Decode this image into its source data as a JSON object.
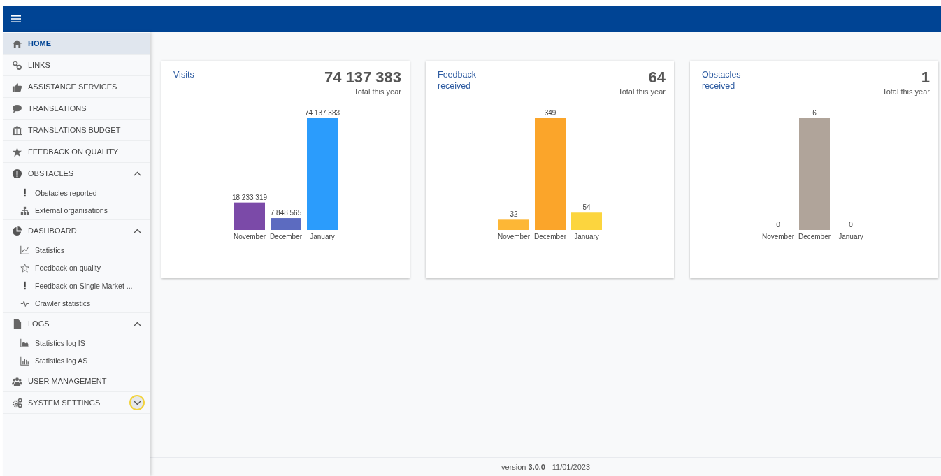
{
  "sidebar": {
    "items": [
      {
        "label": "HOME",
        "selected": true
      },
      {
        "label": "LINKS",
        "selected": false
      },
      {
        "label": "ASSISTANCE SERVICES",
        "selected": false
      },
      {
        "label": "TRANSLATIONS",
        "selected": false
      },
      {
        "label": "TRANSLATIONS BUDGET",
        "selected": false
      },
      {
        "label": "FEEDBACK ON QUALITY",
        "selected": false
      },
      {
        "label": "OBSTACLES",
        "selected": false,
        "focused": false,
        "expanded": true,
        "children": [
          {
            "label": "Obstacles reported",
            "selected": false
          },
          {
            "label": "External organisations",
            "selected": false
          }
        ]
      },
      {
        "label": "DASHBOARD",
        "selected": false,
        "focused": false,
        "expanded": true,
        "children": [
          {
            "label": "Statistics",
            "selected": false
          },
          {
            "label": "Feedback on quality",
            "selected": false
          },
          {
            "label": "Feedback on Single Market ...",
            "selected": false
          },
          {
            "label": "Crawler statistics",
            "selected": false
          }
        ]
      },
      {
        "label": "LOGS",
        "selected": false,
        "focused": false,
        "expanded": true,
        "children": [
          {
            "label": "Statistics log IS",
            "selected": false
          },
          {
            "label": "Statistics log AS",
            "selected": false
          }
        ]
      },
      {
        "label": "USER MANAGEMENT",
        "selected": false
      },
      {
        "label": "SYSTEM SETTINGS",
        "selected": false,
        "focused": true,
        "expanded": false
      }
    ]
  },
  "cards": [
    {
      "title": "Visits",
      "total": "74 137 383",
      "total_label": "Total this year",
      "chart_data": {
        "type": "bar",
        "categories": [
          "November",
          "December",
          "January"
        ],
        "series": [
          {
            "values": [
              18233319,
              7848565,
              74137383
            ]
          }
        ],
        "colors": [
          "#7b4aa8",
          "#5c6bc0",
          "#2b9cfc"
        ],
        "data_labels": true
      }
    },
    {
      "title": "Feedback received",
      "total": "64",
      "total_label": "Total this year",
      "chart_data": {
        "type": "bar",
        "categories": [
          "November",
          "December",
          "January"
        ],
        "series": [
          {
            "values": [
              32,
              349,
              54
            ]
          }
        ],
        "colors": [
          "#fdb736",
          "#fba52a",
          "#fcd53e"
        ],
        "data_labels": true
      }
    },
    {
      "title": "Obstacles received",
      "total": "1",
      "total_label": "Total this year",
      "chart_data": {
        "type": "bar",
        "categories": [
          "November",
          "December",
          "January"
        ],
        "series": [
          {
            "values": [
              0,
              6,
              0
            ]
          }
        ],
        "colors": [
          "#b0a49a",
          "#b0a49a",
          "#b0a49a"
        ],
        "data_labels": true
      }
    }
  ],
  "footer": {
    "text": "version **3.0.0** - 11/01/2023"
  }
}
